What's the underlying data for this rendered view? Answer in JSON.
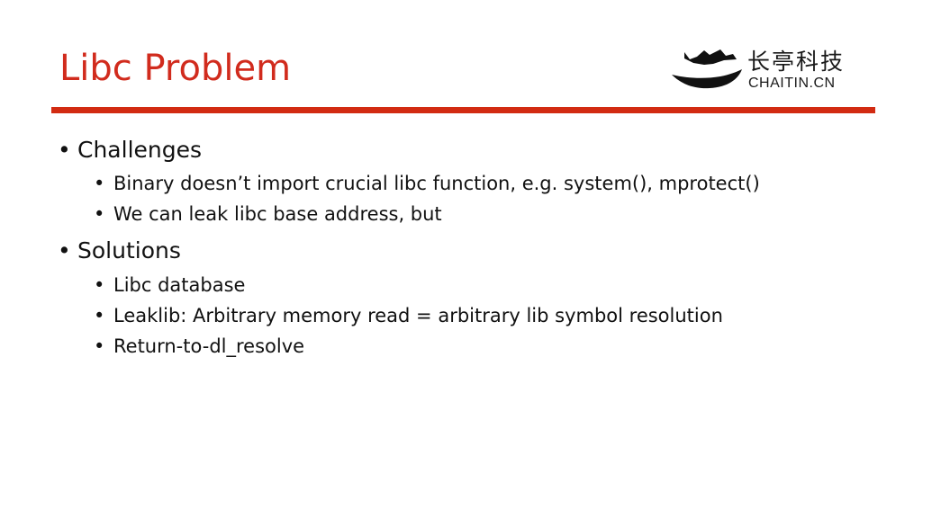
{
  "slide": {
    "title": "Libc Problem"
  },
  "logo": {
    "chinese": "长亭科技",
    "english": "CHAITIN.CN",
    "icon": "chaitin-logo-icon"
  },
  "colors": {
    "title": "#d12b1d",
    "rule": "#d22b12",
    "text": "#111111"
  },
  "bullets": {
    "challenges": {
      "label": "Challenges",
      "items": [
        "Binary doesn’t import crucial libc function, e.g. system(), mprotect()",
        "We can leak libc base address, but"
      ]
    },
    "solutions": {
      "label": "Solutions",
      "items": [
        "Libc database",
        "Leaklib: Arbitrary memory read = arbitrary lib symbol resolution",
        "Return-to-dl_resolve"
      ]
    },
    "marker": "•"
  }
}
